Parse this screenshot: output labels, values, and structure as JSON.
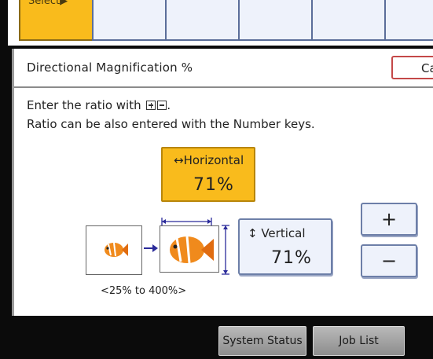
{
  "tabs": {
    "select_label": "Select▶"
  },
  "dialog": {
    "title": "Directional Magnification %",
    "cancel_label": "Ca",
    "instruction_line1": "Enter the ratio with",
    "instruction_line1_end": ".",
    "instruction_line2": "Ratio can be also entered with the Number keys."
  },
  "horizontal": {
    "label": "↔Horizontal",
    "value": "71%"
  },
  "vertical": {
    "label": "↕ Vertical",
    "value": "71%"
  },
  "adjust": {
    "plus_label": "+",
    "minus_label": "−"
  },
  "range_text": "<25% to 400%>",
  "footer": {
    "system_status": "System Status",
    "job_list": "Job List"
  },
  "icons": [
    "plus-key-icon",
    "minus-key-icon",
    "small-fish-icon",
    "right-arrow-icon",
    "large-fish-icon"
  ],
  "colors": {
    "selected": "#f9bb1c",
    "button": "#eef2fb",
    "cancel_border": "#c44848"
  }
}
